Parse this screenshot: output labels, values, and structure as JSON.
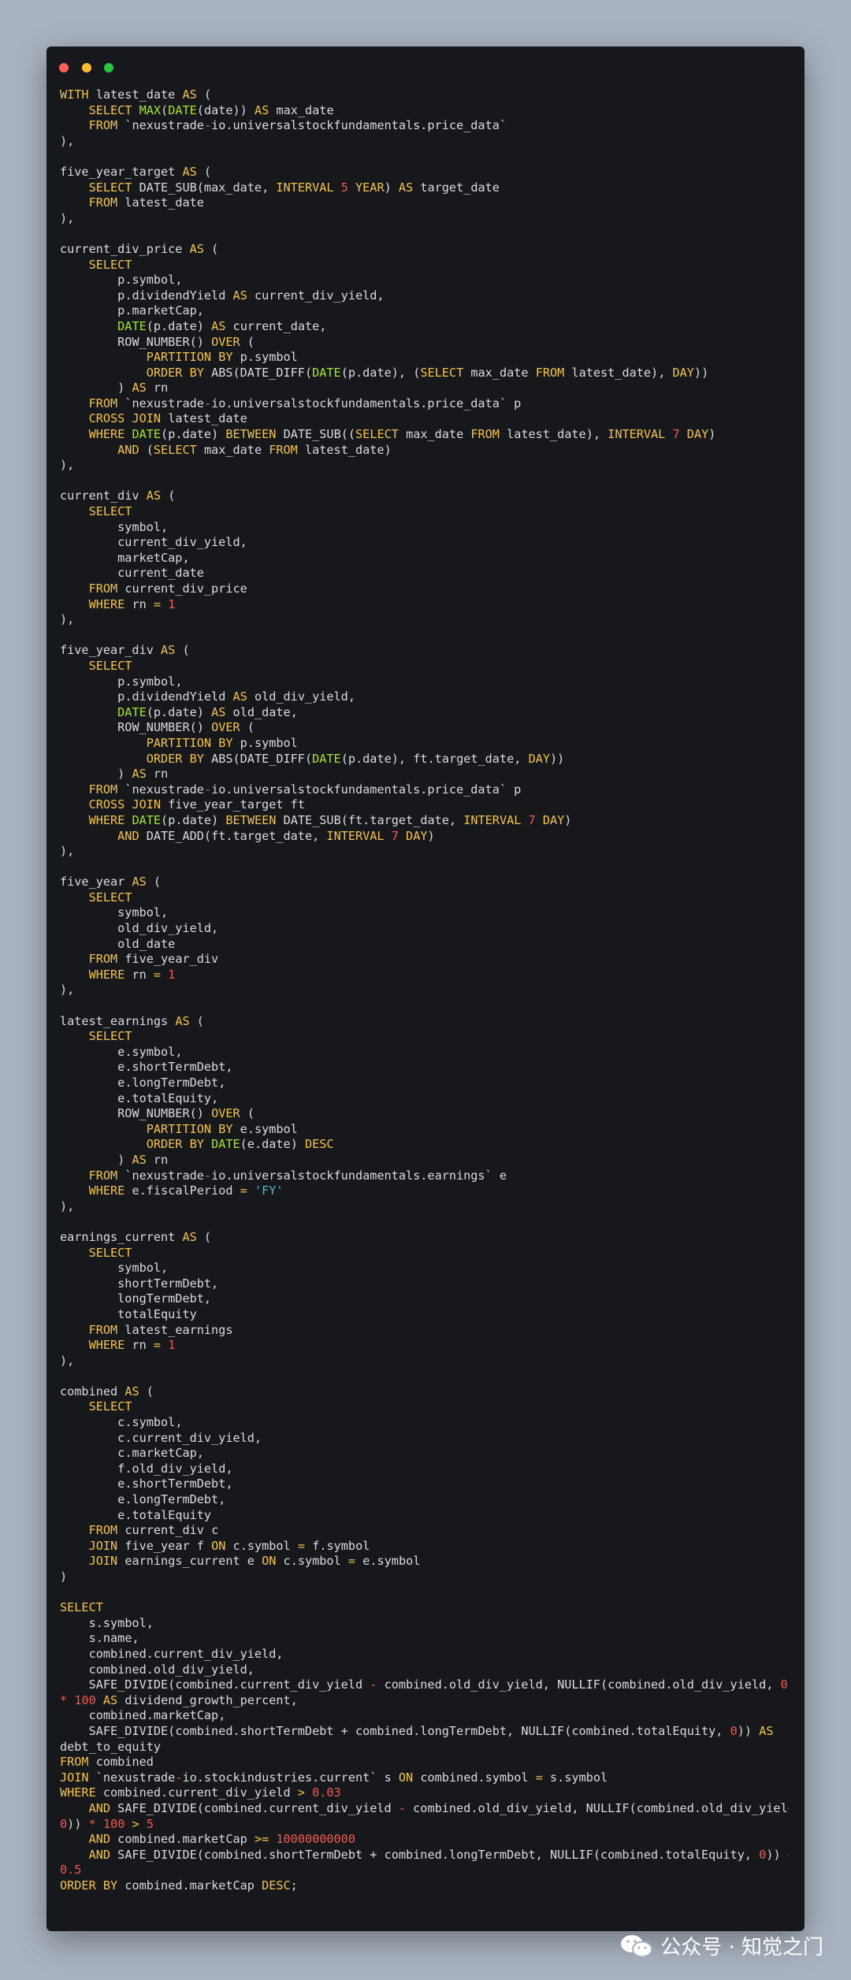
{
  "window": {
    "dot_colors": [
      "#ff5f57",
      "#febc2e",
      "#28c840"
    ]
  },
  "code_lines": [
    "WITH latest_date AS (",
    "    SELECT MAX(DATE(date)) AS max_date",
    "    FROM `nexustrade-io.universalstockfundamentals.price_data`",
    "),",
    "",
    "five_year_target AS (",
    "    SELECT DATE_SUB(max_date, INTERVAL 5 YEAR) AS target_date",
    "    FROM latest_date",
    "),",
    "",
    "current_div_price AS (",
    "    SELECT",
    "        p.symbol,",
    "        p.dividendYield AS current_div_yield,",
    "        p.marketCap,",
    "        DATE(p.date) AS current_date,",
    "        ROW_NUMBER() OVER (",
    "            PARTITION BY p.symbol",
    "            ORDER BY ABS(DATE_DIFF(DATE(p.date), (SELECT max_date FROM latest_date), DAY))",
    "        ) AS rn",
    "    FROM `nexustrade-io.universalstockfundamentals.price_data` p",
    "    CROSS JOIN latest_date",
    "    WHERE DATE(p.date) BETWEEN DATE_SUB((SELECT max_date FROM latest_date), INTERVAL 7 DAY)",
    "        AND (SELECT max_date FROM latest_date)",
    "),",
    "",
    "current_div AS (",
    "    SELECT",
    "        symbol,",
    "        current_div_yield,",
    "        marketCap,",
    "        current_date",
    "    FROM current_div_price",
    "    WHERE rn = 1",
    "),",
    "",
    "five_year_div AS (",
    "    SELECT",
    "        p.symbol,",
    "        p.dividendYield AS old_div_yield,",
    "        DATE(p.date) AS old_date,",
    "        ROW_NUMBER() OVER (",
    "            PARTITION BY p.symbol",
    "            ORDER BY ABS(DATE_DIFF(DATE(p.date), ft.target_date, DAY))",
    "        ) AS rn",
    "    FROM `nexustrade-io.universalstockfundamentals.price_data` p",
    "    CROSS JOIN five_year_target ft",
    "    WHERE DATE(p.date) BETWEEN DATE_SUB(ft.target_date, INTERVAL 7 DAY)",
    "        AND DATE_ADD(ft.target_date, INTERVAL 7 DAY)",
    "),",
    "",
    "five_year AS (",
    "    SELECT",
    "        symbol,",
    "        old_div_yield,",
    "        old_date",
    "    FROM five_year_div",
    "    WHERE rn = 1",
    "),",
    "",
    "latest_earnings AS (",
    "    SELECT",
    "        e.symbol,",
    "        e.shortTermDebt,",
    "        e.longTermDebt,",
    "        e.totalEquity,",
    "        ROW_NUMBER() OVER (",
    "            PARTITION BY e.symbol",
    "            ORDER BY DATE(e.date) DESC",
    "        ) AS rn",
    "    FROM `nexustrade-io.universalstockfundamentals.earnings` e",
    "    WHERE e.fiscalPeriod = 'FY'",
    "),",
    "",
    "earnings_current AS (",
    "    SELECT",
    "        symbol,",
    "        shortTermDebt,",
    "        longTermDebt,",
    "        totalEquity",
    "    FROM latest_earnings",
    "    WHERE rn = 1",
    "),",
    "",
    "combined AS (",
    "    SELECT",
    "        c.symbol,",
    "        c.current_div_yield,",
    "        c.marketCap,",
    "        f.old_div_yield,",
    "        e.shortTermDebt,",
    "        e.longTermDebt,",
    "        e.totalEquity",
    "    FROM current_div c",
    "    JOIN five_year f ON c.symbol = f.symbol",
    "    JOIN earnings_current e ON c.symbol = e.symbol",
    ")",
    "",
    "SELECT",
    "    s.symbol,",
    "    s.name,",
    "    combined.current_div_yield,",
    "    combined.old_div_yield,",
    "    SAFE_DIVIDE(combined.current_div_yield - combined.old_div_yield, NULLIF(combined.old_div_yield, 0))",
    "* 100 AS dividend_growth_percent,",
    "    combined.marketCap,",
    "    SAFE_DIVIDE(combined.shortTermDebt + combined.longTermDebt, NULLIF(combined.totalEquity, 0)) AS",
    "debt_to_equity",
    "FROM combined",
    "JOIN `nexustrade-io.stockindustries.current` s ON combined.symbol = s.symbol",
    "WHERE combined.current_div_yield > 0.03",
    "    AND SAFE_DIVIDE(combined.current_div_yield - combined.old_div_yield, NULLIF(combined.old_div_yield,",
    "0)) * 100 > 5",
    "    AND combined.marketCap >= 10000000000",
    "    AND SAFE_DIVIDE(combined.shortTermDebt + combined.longTermDebt, NULLIF(combined.totalEquity, 0)) <",
    "0.5",
    "ORDER BY combined.marketCap DESC;"
  ],
  "watermark": {
    "text": "公众号 · 知觉之门",
    "icon": "wechat-icon"
  }
}
